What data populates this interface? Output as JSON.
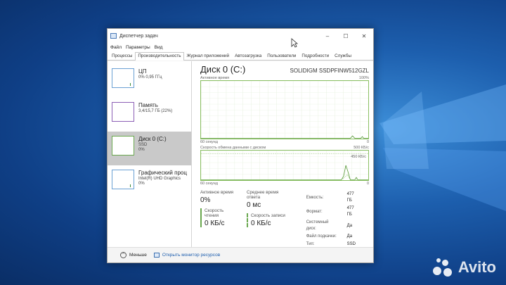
{
  "window": {
    "title": "Диспетчер задач",
    "menu": [
      "Файл",
      "Параметры",
      "Вид"
    ],
    "tabs": [
      "Процессы",
      "Производительность",
      "Журнал приложений",
      "Автозагрузка",
      "Пользователи",
      "Подробности",
      "Службы"
    ],
    "active_tab": "Производительность"
  },
  "sidebar": {
    "items": [
      {
        "title": "ЦП",
        "line1": "0% 0,95 ГГц",
        "line2": ""
      },
      {
        "title": "Память",
        "line1": "3,4/15,7 ГБ (22%)",
        "line2": ""
      },
      {
        "title": "Диск 0 (C:)",
        "line1": "SSD",
        "line2": "0%"
      },
      {
        "title": "Графический проц",
        "line1": "Intel(R) UHD Graphics",
        "line2": "0%"
      }
    ],
    "selected_index": 2
  },
  "main": {
    "title": "Диск 0 (C:)",
    "model": "SOLIDIGM SSDPFINW512GZL",
    "graph1": {
      "label": "Активное время",
      "max": "100%",
      "duration": "60 секунд",
      "min": "0"
    },
    "graph2": {
      "label": "Скорость обмена данными с диском",
      "max": "500 КБ/с",
      "marker": "450 КБ/с",
      "duration": "60 секунд",
      "min": "0"
    },
    "stats": {
      "active_time_label": "Активное время",
      "active_time_value": "0%",
      "response_label": "Среднее время ответа",
      "response_value": "0 мс",
      "read_label": "Скорость чтения",
      "read_value": "0 КБ/с",
      "write_label": "Скорость записи",
      "write_value": "0 КБ/с"
    },
    "properties": [
      {
        "label": "Емкость:",
        "value": "477 ГБ"
      },
      {
        "label": "Формат:",
        "value": "477 ГБ"
      },
      {
        "label": "Системный диск:",
        "value": "Да"
      },
      {
        "label": "Файл подкачки:",
        "value": "Да"
      },
      {
        "label": "Тип:",
        "value": "SSD"
      }
    ]
  },
  "footer": {
    "less_label": "Меньше",
    "monitor_link": "Открыть монитор ресурсов"
  },
  "watermark": {
    "text": "Avito"
  },
  "colors": {
    "disk_accent": "#6aa84f",
    "link": "#1f5fae",
    "desktop": "#1d5fae"
  }
}
